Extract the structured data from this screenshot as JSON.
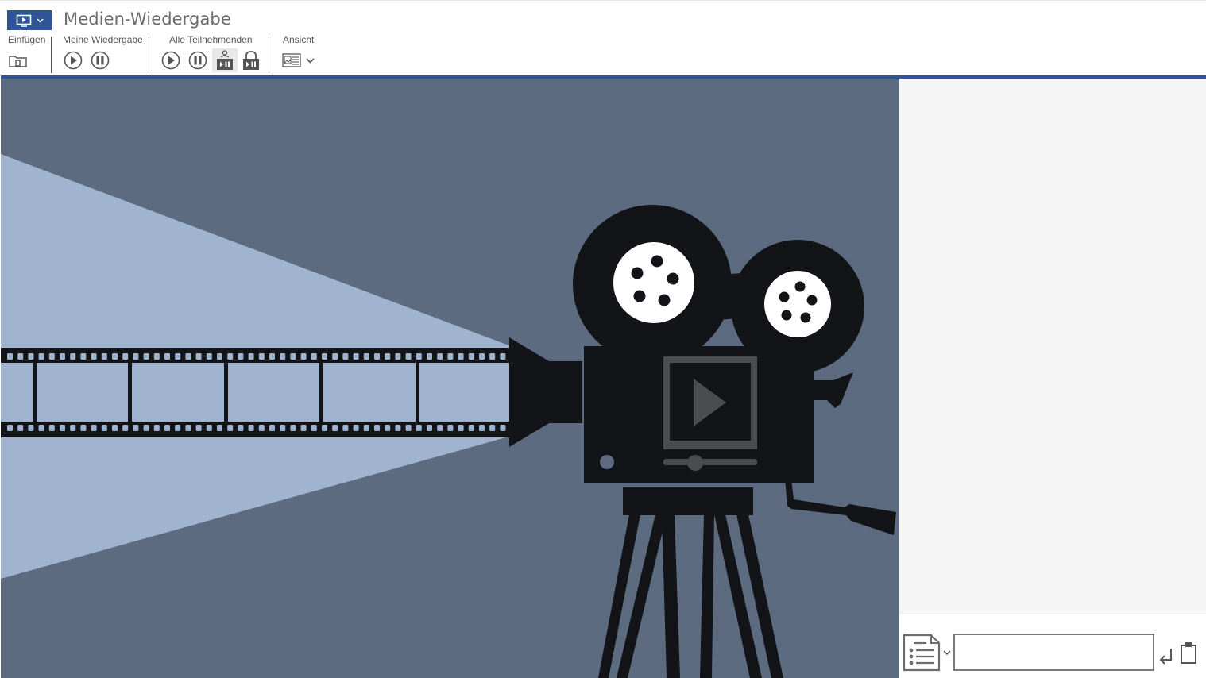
{
  "app": {
    "title": "Medien-Wiedergabe",
    "accent_color": "#2f5597",
    "menu_button_icons": [
      "media-player-icon",
      "chevron-down-icon"
    ]
  },
  "toolbar": {
    "groups": [
      {
        "label": "Einfügen",
        "tools": [
          {
            "icon": "insert-media-icon"
          }
        ]
      },
      {
        "label": "Meine Wiedergabe",
        "tools": [
          {
            "icon": "play-icon"
          },
          {
            "icon": "pause-icon"
          }
        ]
      },
      {
        "label": "Alle Teilnehmenden",
        "tools": [
          {
            "icon": "play-icon"
          },
          {
            "icon": "pause-icon"
          },
          {
            "icon": "sync-presenter-icon",
            "active": true
          },
          {
            "icon": "lock-playback-icon"
          }
        ]
      },
      {
        "label": "Ansicht",
        "tools": [
          {
            "icon": "view-layout-icon"
          },
          {
            "icon": "chevron-down-icon"
          }
        ]
      }
    ]
  },
  "stage": {
    "content": "movie-camera-illustration",
    "background_color": "#5c6b80",
    "beam_color": "#a0b4cf",
    "ink_color": "#131417",
    "play_overlay_icon": "play-icon"
  },
  "chat": {
    "input_value": "",
    "input_placeholder": "",
    "format_icon": "document-list-icon",
    "send_icon": "enter-icon",
    "clipboard_icon": "clipboard-icon"
  }
}
